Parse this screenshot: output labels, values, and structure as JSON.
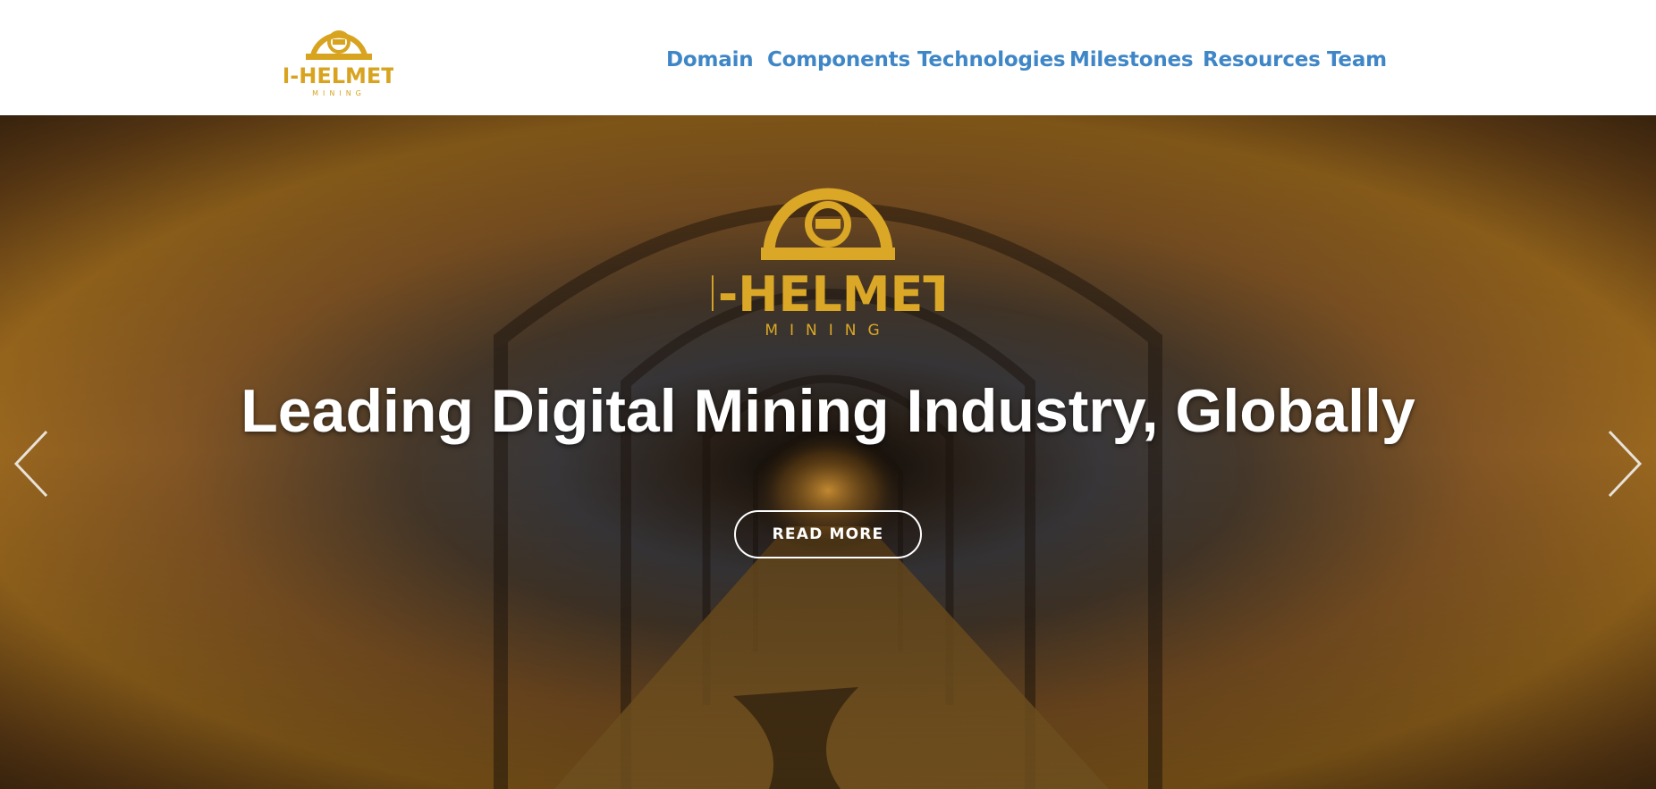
{
  "brand": {
    "name": "I-HELMET",
    "tagline": "MINING",
    "logo_color": "#d8a420"
  },
  "nav": {
    "items": [
      {
        "label": "Domain"
      },
      {
        "label": "Components"
      },
      {
        "label": "Technologies"
      },
      {
        "label": "Milestones"
      },
      {
        "label": "Resources"
      },
      {
        "label": "Team"
      }
    ],
    "link_color": "#3f86c7"
  },
  "hero": {
    "headline": "Leading Digital Mining Industry, Globally",
    "button_label": "READ MORE",
    "prev_icon": "chevron-left-icon",
    "next_icon": "chevron-right-icon"
  }
}
